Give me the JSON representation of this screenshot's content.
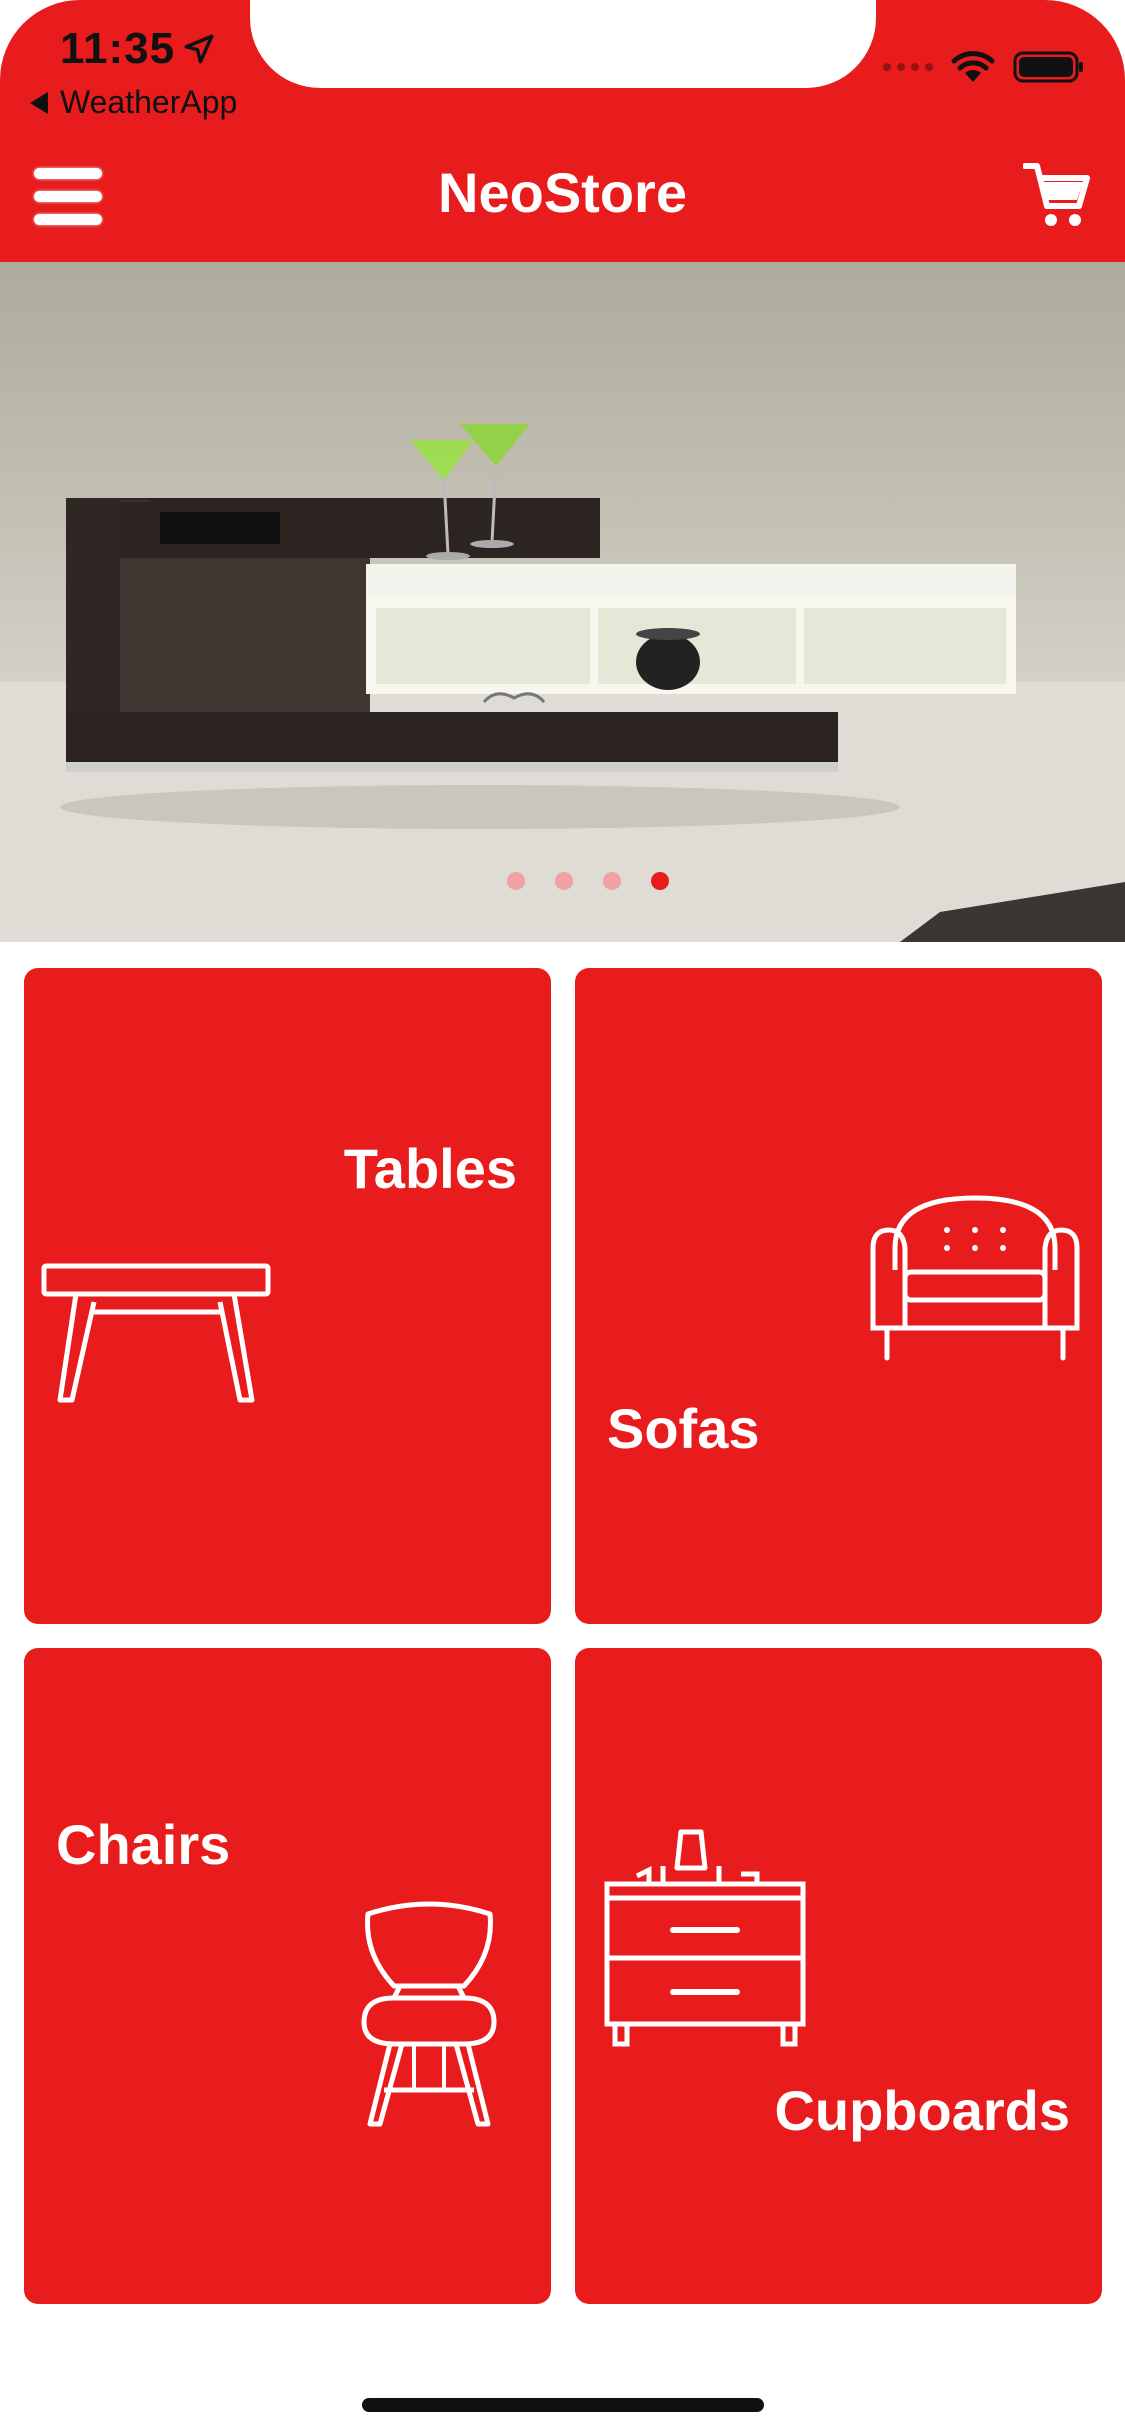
{
  "status_bar": {
    "time": "11:35",
    "back_app": "WeatherApp"
  },
  "navbar": {
    "title": "NeoStore",
    "menu_icon": "hamburger-menu-icon",
    "cart_icon": "shopping-cart-icon"
  },
  "banner": {
    "slide_count": 4,
    "active_index": 3
  },
  "categories": [
    {
      "label": "Tables",
      "icon": "table-icon"
    },
    {
      "label": "Sofas",
      "icon": "sofa-icon"
    },
    {
      "label": "Chairs",
      "icon": "chair-icon"
    },
    {
      "label": "Cupboards",
      "icon": "cupboard-icon"
    }
  ],
  "colors": {
    "brand": "#E81C1C",
    "dot_inactive": "#EFA3A3"
  }
}
